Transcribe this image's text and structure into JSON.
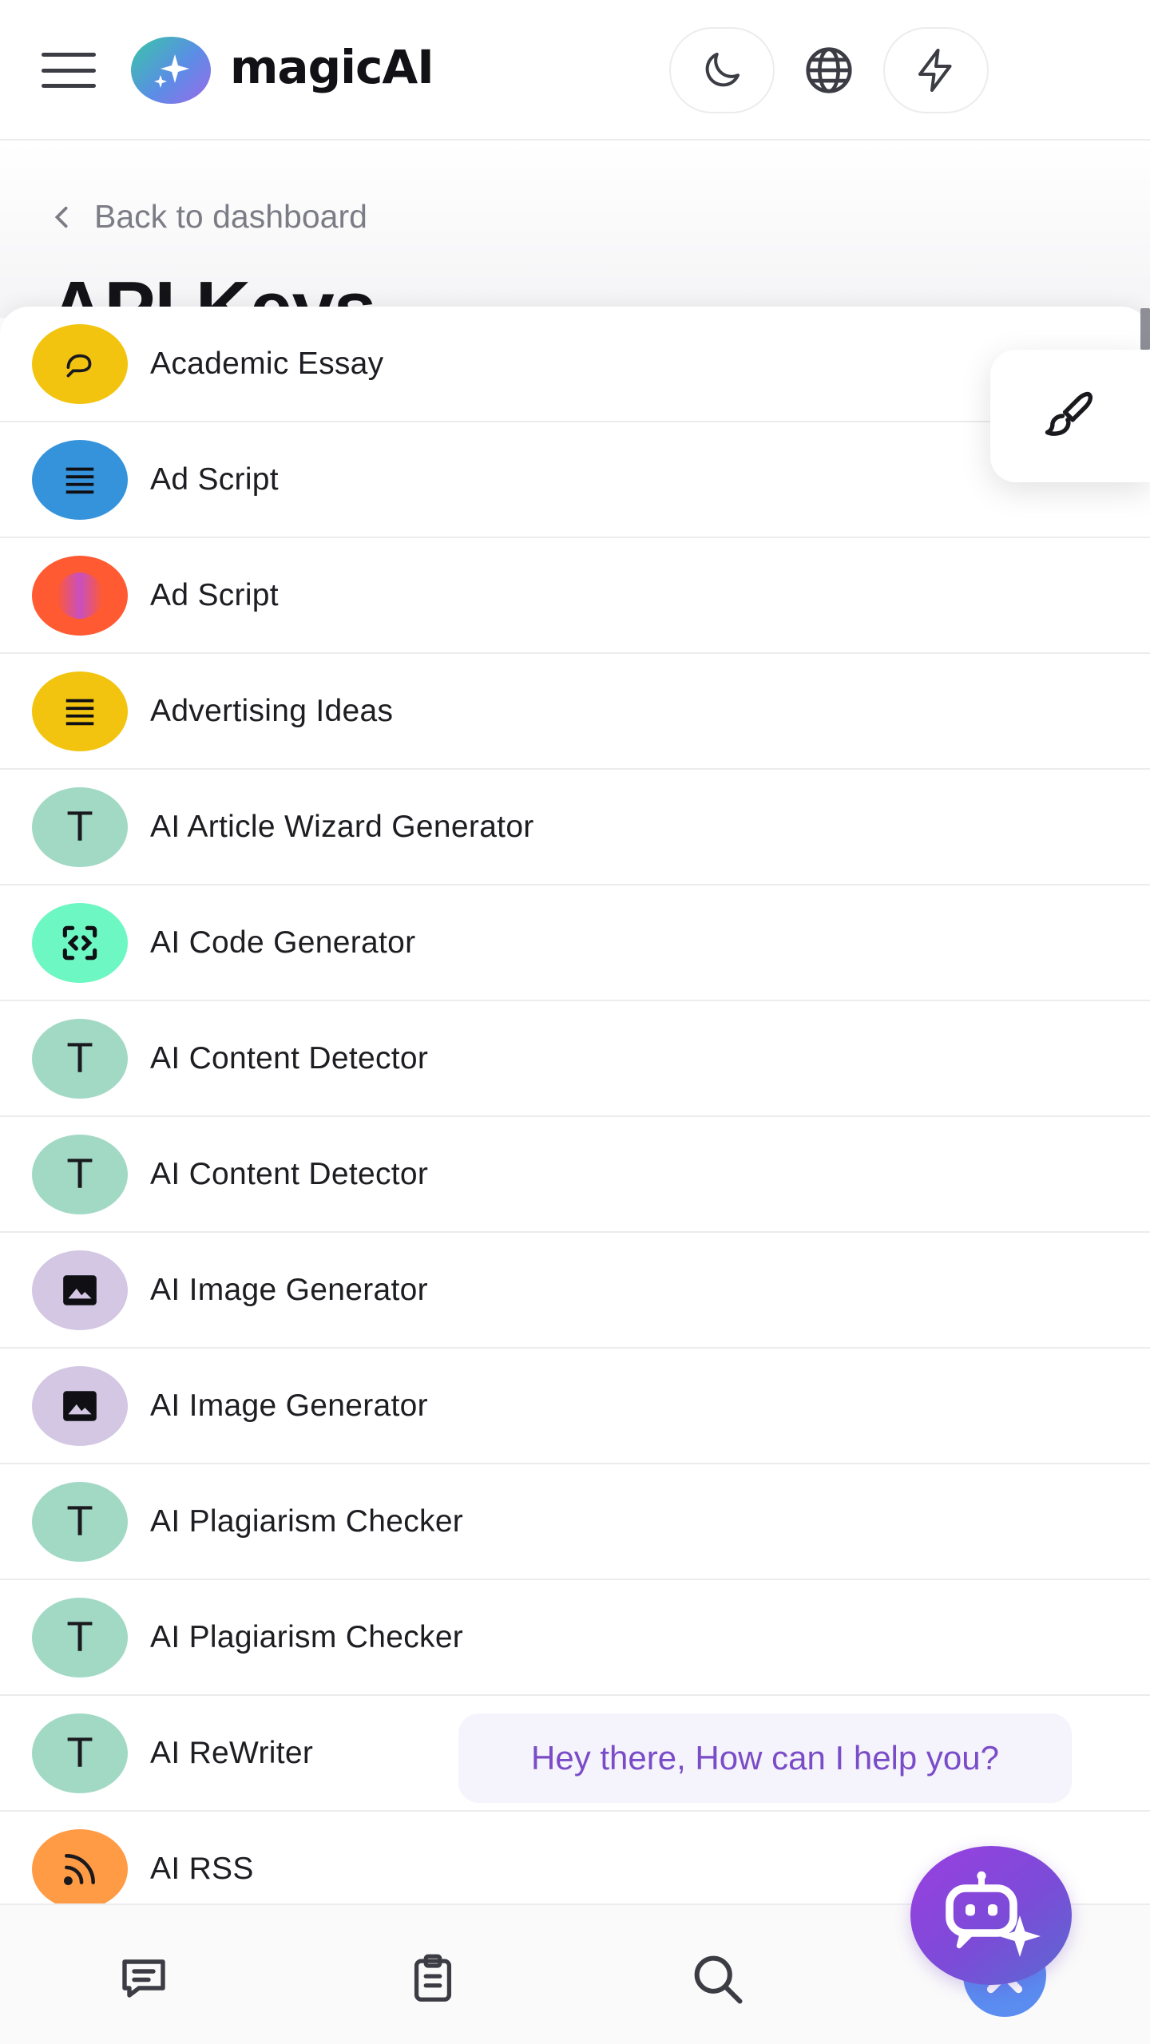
{
  "header": {
    "brand": "magicAI",
    "icons": [
      "menu-icon",
      "moon-icon",
      "globe-icon",
      "lightning-icon"
    ]
  },
  "page": {
    "back_label": "Back to dashboard",
    "title": "API Keys"
  },
  "templates": [
    {
      "label": "Academic Essay",
      "icon": "pen-icon",
      "color": "#f2c40f"
    },
    {
      "label": "Ad Script",
      "icon": "lines-icon",
      "color": "#3593dc"
    },
    {
      "label": "Ad Script",
      "icon": "gradient-icon",
      "color": "#ff5a32"
    },
    {
      "label": "Advertising Ideas",
      "icon": "lines-icon",
      "color": "#f2c40f"
    },
    {
      "label": "AI Article Wizard Generator",
      "icon": "letter-t-icon",
      "letter": "T",
      "color": "#a2d9c5"
    },
    {
      "label": "AI Code Generator",
      "icon": "code-scan-icon",
      "color": "#6cf7c3"
    },
    {
      "label": "AI Content Detector",
      "icon": "letter-t-icon",
      "letter": "T",
      "color": "#a2d9c5"
    },
    {
      "label": "AI Content Detector",
      "icon": "letter-t-icon",
      "letter": "T",
      "color": "#a2d9c5"
    },
    {
      "label": "AI Image Generator",
      "icon": "image-icon",
      "color": "#d3c7e3"
    },
    {
      "label": "AI Image Generator",
      "icon": "image-icon",
      "color": "#d3c7e3"
    },
    {
      "label": "AI Plagiarism Checker",
      "icon": "letter-t-icon",
      "letter": "T",
      "color": "#a2d9c5"
    },
    {
      "label": "AI Plagiarism Checker",
      "icon": "letter-t-icon",
      "letter": "T",
      "color": "#a2d9c5"
    },
    {
      "label": "AI ReWriter",
      "icon": "letter-t-icon",
      "letter": "T",
      "color": "#a2d9c5"
    },
    {
      "label": "AI RSS",
      "icon": "rss-icon",
      "color": "#ff9a45"
    }
  ],
  "chat": {
    "greeting": "Hey there, How can I help you?"
  },
  "bottom_nav": {
    "icons": [
      "chat-icon",
      "clipboard-icon",
      "search-icon",
      "close-icon"
    ]
  },
  "colors": {
    "accent_purple": "#7a4cc8",
    "nav_active": "#5b8cf0"
  }
}
